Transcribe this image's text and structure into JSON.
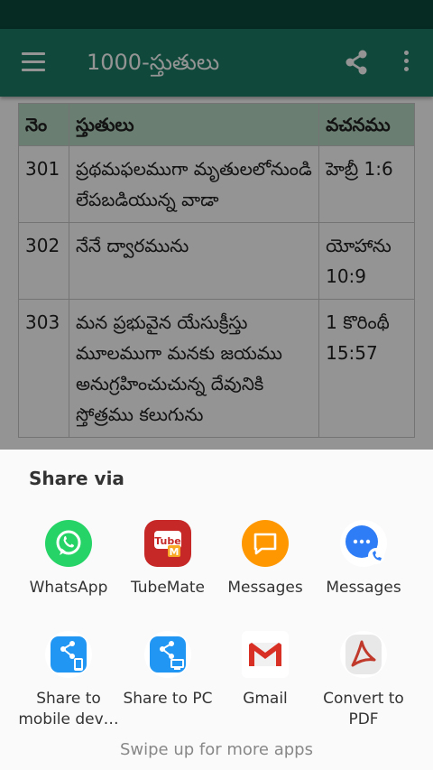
{
  "app": {
    "title": "1000-స్తుతులు"
  },
  "table": {
    "headers": [
      "నెం",
      "స్తుతులు",
      "వచనము"
    ],
    "rows": [
      {
        "no": "301",
        "praise": "ప్రథమఫలముగా మృతులలోనుండి లేపబడియున్న వాడా",
        "verse": "హెబ్రీ 1:6"
      },
      {
        "no": "302",
        "praise": "నేనే ద్వారమును",
        "verse": "యోహాను 10:9"
      },
      {
        "no": "303",
        "praise": "మన ప్రభువైన యేసుక్రీస్తు మూలముగా మనకు జయము అనుగ్రహించుచున్న దేవునికి స్తోత్రము కలుగును",
        "verse": "1 కొరింథీ 15:57"
      }
    ]
  },
  "share_sheet": {
    "title": "Share via",
    "apps": [
      {
        "label": "WhatsApp",
        "icon": "whatsapp-icon",
        "color": "#25d366"
      },
      {
        "label": "TubeMate",
        "icon": "tubemate-icon",
        "color": "#c62828"
      },
      {
        "label": "Messages",
        "icon": "messages-icon",
        "color": "#ff9800"
      },
      {
        "label": "Messages",
        "icon": "chat-icon",
        "color": "#2f7df6"
      },
      {
        "label": "Share to mobile dev…",
        "icon": "share-to-mobile-icon",
        "color": "#2196f3"
      },
      {
        "label": "Share to PC",
        "icon": "share-to-pc-icon",
        "color": "#2196f3"
      },
      {
        "label": "Gmail",
        "icon": "gmail-icon",
        "color": "#d93025"
      },
      {
        "label": "Convert to PDF",
        "icon": "pdf-icon",
        "color": "#c0392b"
      }
    ],
    "hint": "Swipe up for more apps"
  }
}
